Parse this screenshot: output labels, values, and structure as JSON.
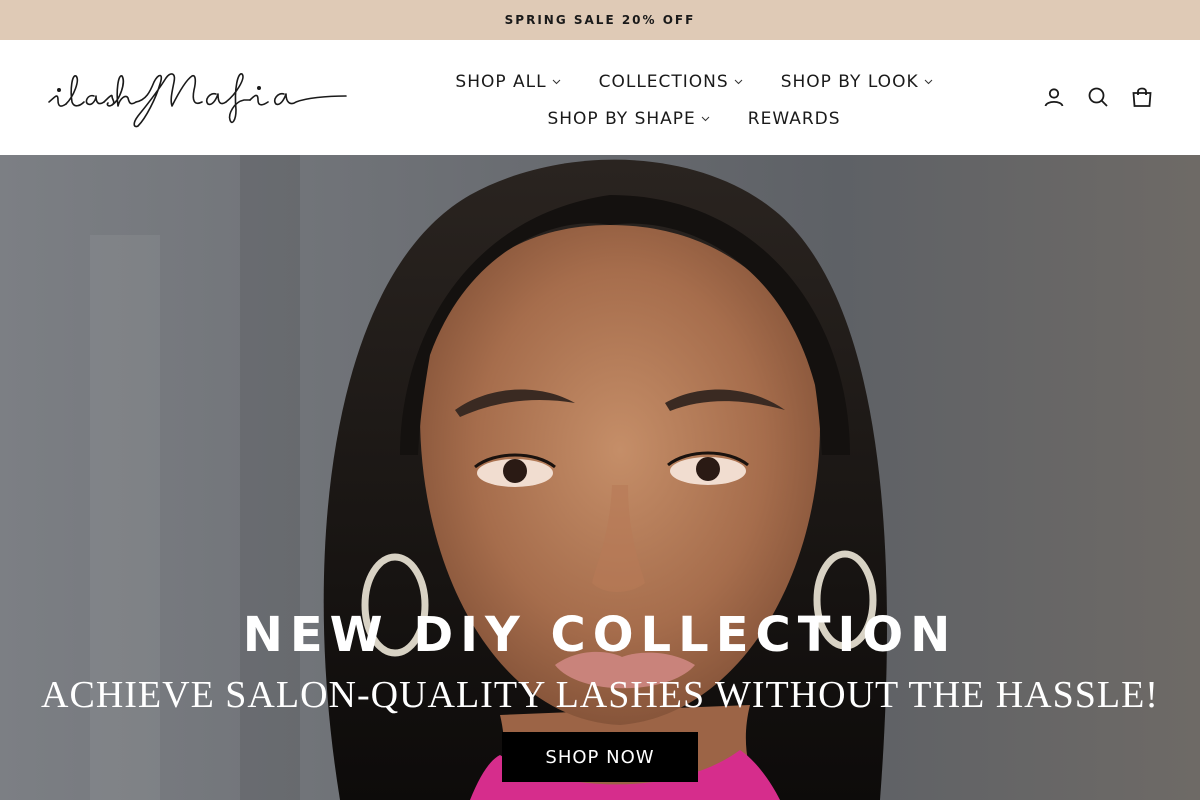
{
  "announcement": {
    "text": "SPRING SALE 20% OFF"
  },
  "header": {
    "logo_text": "ilashMafia",
    "nav": {
      "row1": [
        {
          "label": "SHOP ALL",
          "has_dropdown": true
        },
        {
          "label": "COLLECTIONS",
          "has_dropdown": true
        },
        {
          "label": "SHOP BY LOOK",
          "has_dropdown": true
        }
      ],
      "row2": [
        {
          "label": "SHOP BY SHAPE",
          "has_dropdown": true
        },
        {
          "label": "REWARDS",
          "has_dropdown": false
        }
      ]
    },
    "icons": [
      "account-icon",
      "search-icon",
      "cart-icon"
    ]
  },
  "hero": {
    "title": "NEW DIY COLLECTION",
    "subtitle": "ACHIEVE SALON-QUALITY LASHES WITHOUT THE HASSLE!",
    "cta_label": "SHOP NOW"
  },
  "colors": {
    "announcement_bg": "#dfcab6",
    "cta_bg": "#000000",
    "text_light": "#ffffff"
  }
}
